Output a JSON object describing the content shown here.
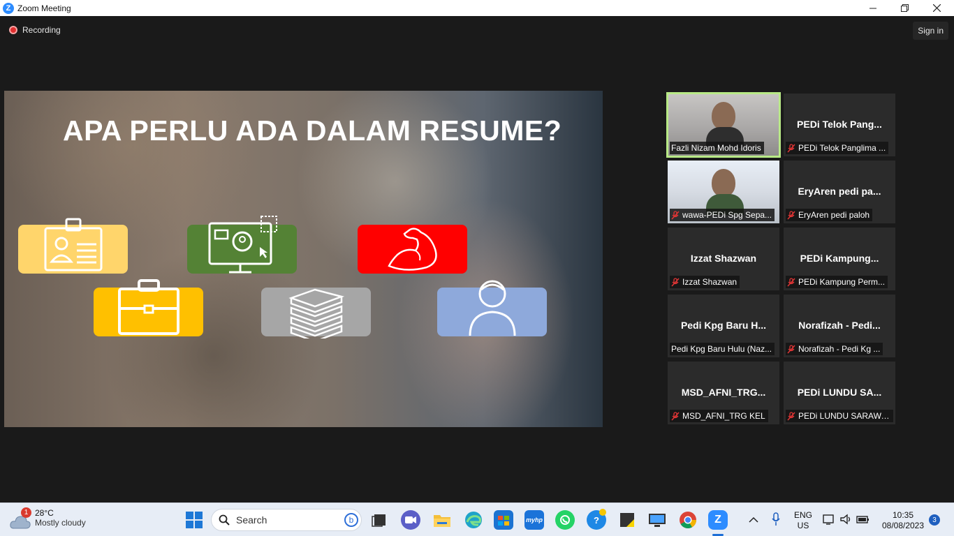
{
  "window": {
    "title": "Zoom Meeting",
    "app_icon_letter": "Z"
  },
  "header": {
    "recording_label": "Recording",
    "signin_label": "Sign in"
  },
  "slide": {
    "title": "APA PERLU ADA DALAM RESUME?",
    "tiles": [
      {
        "name": "id-card-icon",
        "color": "#ffd56b"
      },
      {
        "name": "computer-profile-icon",
        "color": "#548235"
      },
      {
        "name": "flexed-arm-icon",
        "color": "#ff0000"
      },
      {
        "name": "briefcase-icon",
        "color": "#ffc000"
      },
      {
        "name": "books-icon",
        "color": "#a6a6a6"
      },
      {
        "name": "person-icon",
        "color": "#8ea9db"
      }
    ]
  },
  "participants": [
    {
      "display_name": "",
      "label": "Fazli Nizam Mohd Idoris",
      "video": true,
      "muted": false,
      "active": true
    },
    {
      "display_name": "PEDi Telok Pang...",
      "label": "PEDi Telok Panglima ...",
      "video": false,
      "muted": true
    },
    {
      "display_name": "",
      "label": "wawa-PEDi Spg Sepa...",
      "video": true,
      "muted": true
    },
    {
      "display_name": "EryAren pedi pa...",
      "label": "EryAren pedi paloh",
      "video": false,
      "muted": true
    },
    {
      "display_name": "Izzat Shazwan",
      "label": "Izzat Shazwan",
      "video": false,
      "muted": true
    },
    {
      "display_name": "PEDi  Kampung...",
      "label": "PEDi Kampung Perm...",
      "video": false,
      "muted": true
    },
    {
      "display_name": "Pedi Kpg Baru H...",
      "label": "Pedi Kpg Baru Hulu (Naz...",
      "video": false,
      "muted": false
    },
    {
      "display_name": "Norafizah - Pedi...",
      "label": "Norafizah - Pedi Kg ...",
      "video": false,
      "muted": true
    },
    {
      "display_name": "MSD_AFNI_TRG...",
      "label": "MSD_AFNI_TRG KEL",
      "video": false,
      "muted": true
    },
    {
      "display_name": "PEDi LUNDU SA...",
      "label": "PEDi LUNDU SARAWAK",
      "video": false,
      "muted": true
    }
  ],
  "taskbar": {
    "weather_temp": "28°C",
    "weather_cond": "Mostly cloudy",
    "weather_badge": "1",
    "search_placeholder": "Search",
    "lang_top": "ENG",
    "lang_bottom": "US",
    "time": "10:35",
    "date": "08/08/2023",
    "notif_count": "3",
    "myhp_label": "myhp"
  }
}
